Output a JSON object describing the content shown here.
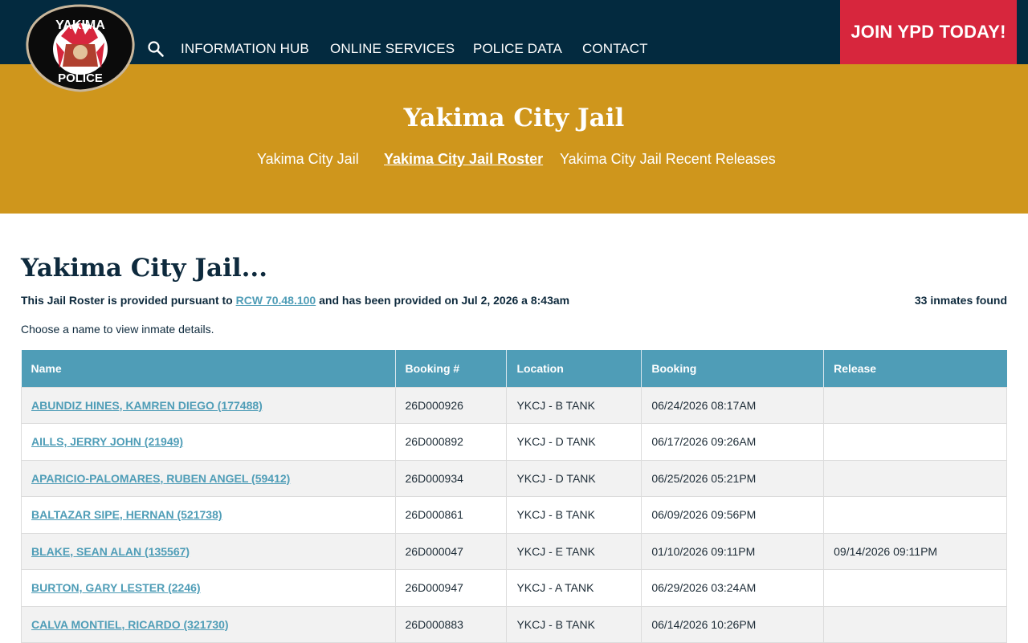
{
  "header": {
    "logo_text_top": "YAKIMA",
    "logo_text_bottom": "POLICE",
    "nav": [
      "INFORMATION HUB",
      "ONLINE SERVICES",
      "POLICE DATA",
      "CONTACT"
    ],
    "join_label": "JOIN YPD TODAY!"
  },
  "hero": {
    "title": "Yakima City Jail",
    "subnav": [
      "Yakima City Jail",
      "Yakima City Jail Roster",
      "Yakima City Jail Recent Releases"
    ],
    "active_subnav": "Yakima City Jail Roster"
  },
  "main": {
    "title": "Yakima City Jail...",
    "roster_prefix": "This Jail Roster is provided pursuant to ",
    "roster_link": "RCW 70.48.100",
    "roster_suffix": " and has been provided on Jul 2, 2026 a 8:43am",
    "inmate_count": "33 inmates found",
    "choose_text": "Choose a name to view inmate details."
  },
  "table": {
    "columns": [
      "Name",
      "Booking #",
      "Location",
      "Booking",
      "Release"
    ],
    "rows": [
      [
        "ABUNDIZ HINES, KAMREN DIEGO (177488)",
        "26D000926",
        "YKCJ - B TANK",
        "06/24/2026 08:17AM",
        ""
      ],
      [
        "AILLS, JERRY JOHN (21949)",
        "26D000892",
        "YKCJ - D TANK",
        "06/17/2026 09:26AM",
        ""
      ],
      [
        "APARICIO-PALOMARES, RUBEN ANGEL (59412)",
        "26D000934",
        "YKCJ - D TANK",
        "06/25/2026 05:21PM",
        ""
      ],
      [
        "BALTAZAR SIPE, HERNAN (521738)",
        "26D000861",
        "YKCJ - B TANK",
        "06/09/2026 09:56PM",
        ""
      ],
      [
        "BLAKE, SEAN ALAN (135567)",
        "26D000047",
        "YKCJ - E TANK",
        "01/10/2026 09:11PM",
        "09/14/2026 09:11PM"
      ],
      [
        "BURTON, GARY LESTER (2246)",
        "26D000947",
        "YKCJ - A TANK",
        "06/29/2026 03:24AM",
        ""
      ],
      [
        "CALVA MONTIEL, RICARDO (321730)",
        "26D000883",
        "YKCJ - B TANK",
        "06/14/2026 10:26PM",
        ""
      ]
    ]
  },
  "colors": {
    "topbar": "#032a3f",
    "hero": "#cf961c",
    "join": "#d7263d",
    "table_header": "#4f9db7",
    "link": "#4f9db7"
  },
  "icons": {
    "search": "search-icon",
    "logo": "police-badge-logo"
  }
}
